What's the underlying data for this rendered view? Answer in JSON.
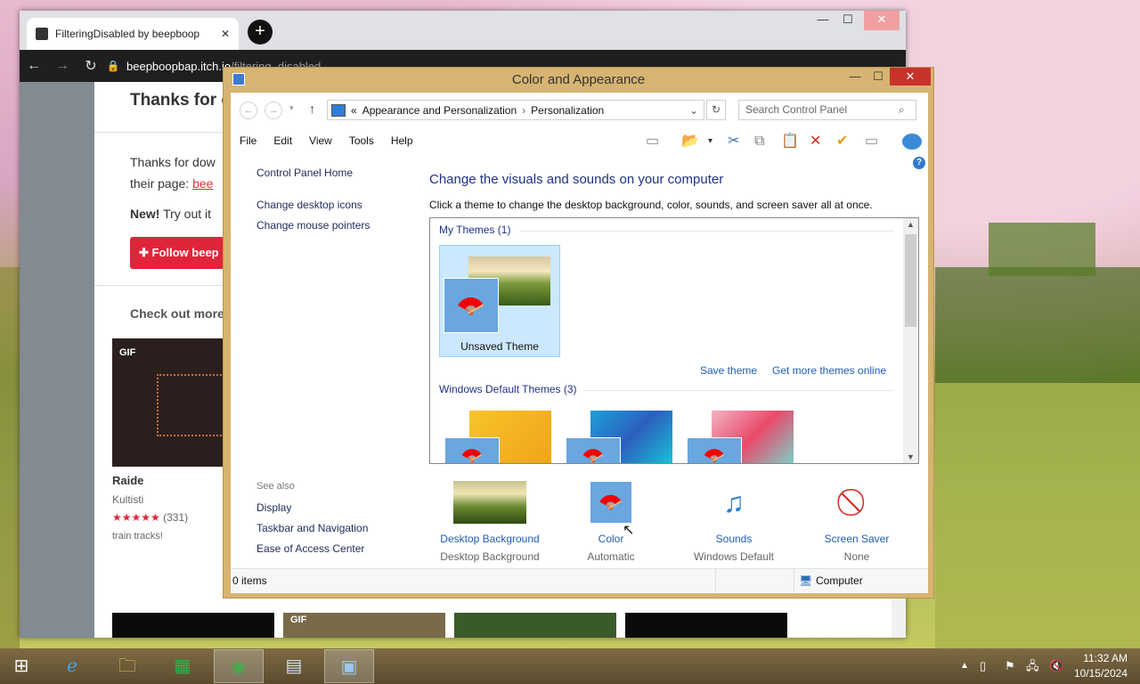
{
  "browser": {
    "tab_title": "FilteringDisabled by beepboop",
    "tab_close": "✕",
    "new_tab": "+",
    "url_host": "beepboopbap.itch.io",
    "url_path": "/filtering_disabled",
    "win_min": "—",
    "win_max": "☐",
    "win_close": "✕",
    "page": {
      "thanks_heading": "Thanks for d",
      "thanks_line1": "Thanks for dow",
      "thanks_line2": "their page:",
      "thanks_link": "bee",
      "new_label": "New!",
      "new_text": "Try out it",
      "follow_button": "Follow beep",
      "check_out": "Check out more",
      "card1_tag": "GIF",
      "card1_title": "Raide",
      "card1_author": "Kultisti",
      "card1_rating": "(331)",
      "card1_desc": "train tracks!",
      "card2_tag": "GIF"
    }
  },
  "control_panel": {
    "title": "Color and Appearance",
    "address": {
      "sep": "«",
      "crumb1": "Appearance and Personalization",
      "crumb2": "Personalization",
      "search_placeholder": "Search Control Panel"
    },
    "menu": [
      "File",
      "Edit",
      "View",
      "Tools",
      "Help"
    ],
    "left_nav": {
      "home": "Control Panel Home",
      "desktop_icons": "Change desktop icons",
      "mouse_pointers": "Change mouse pointers",
      "see_also": "See also",
      "display": "Display",
      "taskbar": "Taskbar and Navigation",
      "ease": "Ease of Access Center"
    },
    "heading": "Change the visuals and sounds on your computer",
    "subheading": "Click a theme to change the desktop background, color, sounds, and screen saver all at once.",
    "my_themes": "My Themes (1)",
    "unsaved_theme": "Unsaved Theme",
    "save_theme": "Save theme",
    "get_more": "Get more themes online",
    "default_themes": "Windows Default Themes (3)",
    "bottom": [
      {
        "label": "Desktop Background",
        "sub": "Desktop Background"
      },
      {
        "label": "Color",
        "sub": "Automatic"
      },
      {
        "label": "Sounds",
        "sub": "Windows Default"
      },
      {
        "label": "Screen Saver",
        "sub": "None"
      }
    ],
    "status_items": "0 items",
    "status_computer": "Computer"
  },
  "taskbar": {
    "time": "11:32 AM",
    "date": "10/15/2024"
  },
  "colors": {
    "cp_frame": "#d7b471",
    "link": "#1f5db5",
    "heading": "#1e3287"
  }
}
